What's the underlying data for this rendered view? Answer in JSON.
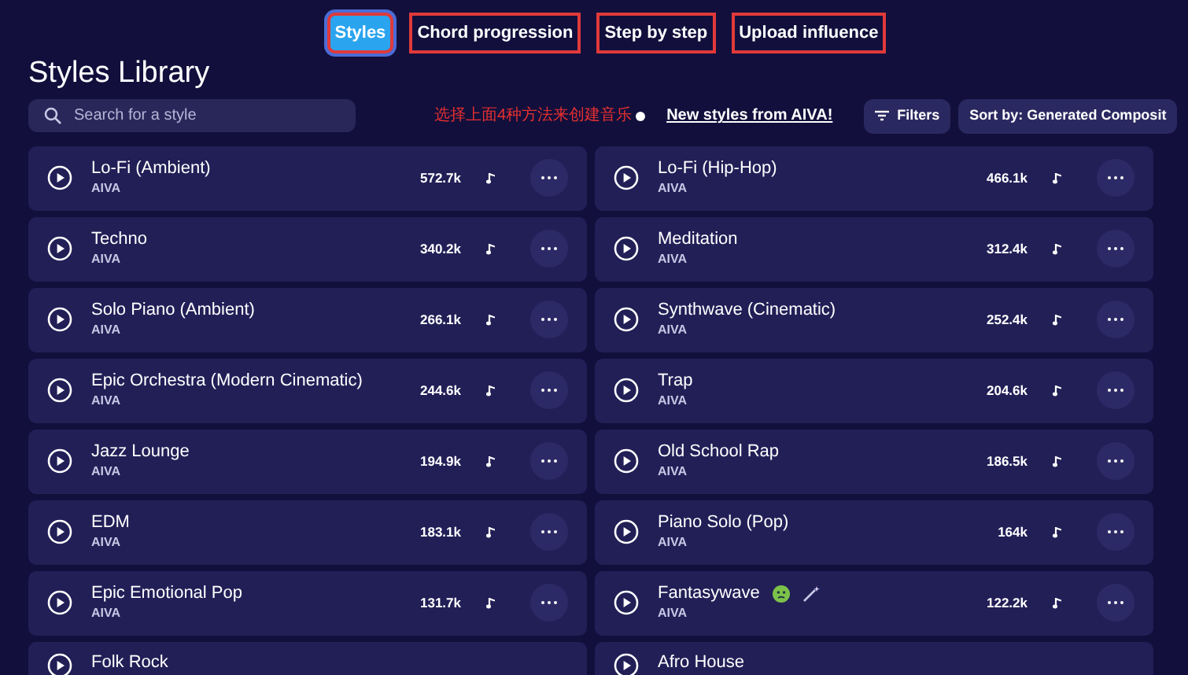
{
  "tabs": [
    {
      "label": "Styles",
      "selected": true,
      "annotated": true
    },
    {
      "label": "Chord progression",
      "selected": false,
      "annotated": true
    },
    {
      "label": "Step by step",
      "selected": false,
      "annotated": true
    },
    {
      "label": "Upload influence",
      "selected": false,
      "annotated": true
    }
  ],
  "title": "Styles Library",
  "search": {
    "placeholder": "Search for a style"
  },
  "annotation": "选择上面4种方法来创建音乐",
  "new_styles_link": "New styles from AIVA!",
  "filters_button": "Filters",
  "sort_button": "Sort by: Generated Composit",
  "styles": [
    {
      "name": "Lo-Fi (Ambient)",
      "author": "AIVA",
      "count": "572.7k",
      "kind": "plain"
    },
    {
      "name": "Lo-Fi (Hip-Hop)",
      "author": "AIVA",
      "count": "466.1k",
      "kind": "plain"
    },
    {
      "name": "Techno",
      "author": "AIVA",
      "count": "340.2k",
      "kind": "plain"
    },
    {
      "name": "Meditation",
      "author": "AIVA",
      "count": "312.4k",
      "kind": "plain"
    },
    {
      "name": "Solo Piano (Ambient)",
      "author": "AIVA",
      "count": "266.1k",
      "kind": "plain"
    },
    {
      "name": "Synthwave (Cinematic)",
      "author": "AIVA",
      "count": "252.4k",
      "kind": "plain"
    },
    {
      "name": "Epic Orchestra (Modern Cinematic)",
      "author": "AIVA",
      "count": "244.6k",
      "kind": "plain"
    },
    {
      "name": "Trap",
      "author": "AIVA",
      "count": "204.6k",
      "kind": "plain"
    },
    {
      "name": "Jazz Lounge",
      "author": "AIVA",
      "count": "194.9k",
      "kind": "plain"
    },
    {
      "name": "Old School Rap",
      "author": "AIVA",
      "count": "186.5k",
      "kind": "plain"
    },
    {
      "name": "EDM",
      "author": "AIVA",
      "count": "183.1k",
      "kind": "plain"
    },
    {
      "name": "Piano Solo (Pop)",
      "author": "AIVA",
      "count": "164k",
      "kind": "plain"
    },
    {
      "name": "Epic Emotional Pop",
      "author": "AIVA",
      "count": "131.7k",
      "kind": "plain"
    },
    {
      "name": "Fantasywave",
      "author": "AIVA",
      "count": "122.2k",
      "kind": "emoji"
    },
    {
      "name": "Folk Rock",
      "kind": "partial"
    },
    {
      "name": "Afro House",
      "kind": "partial"
    }
  ]
}
